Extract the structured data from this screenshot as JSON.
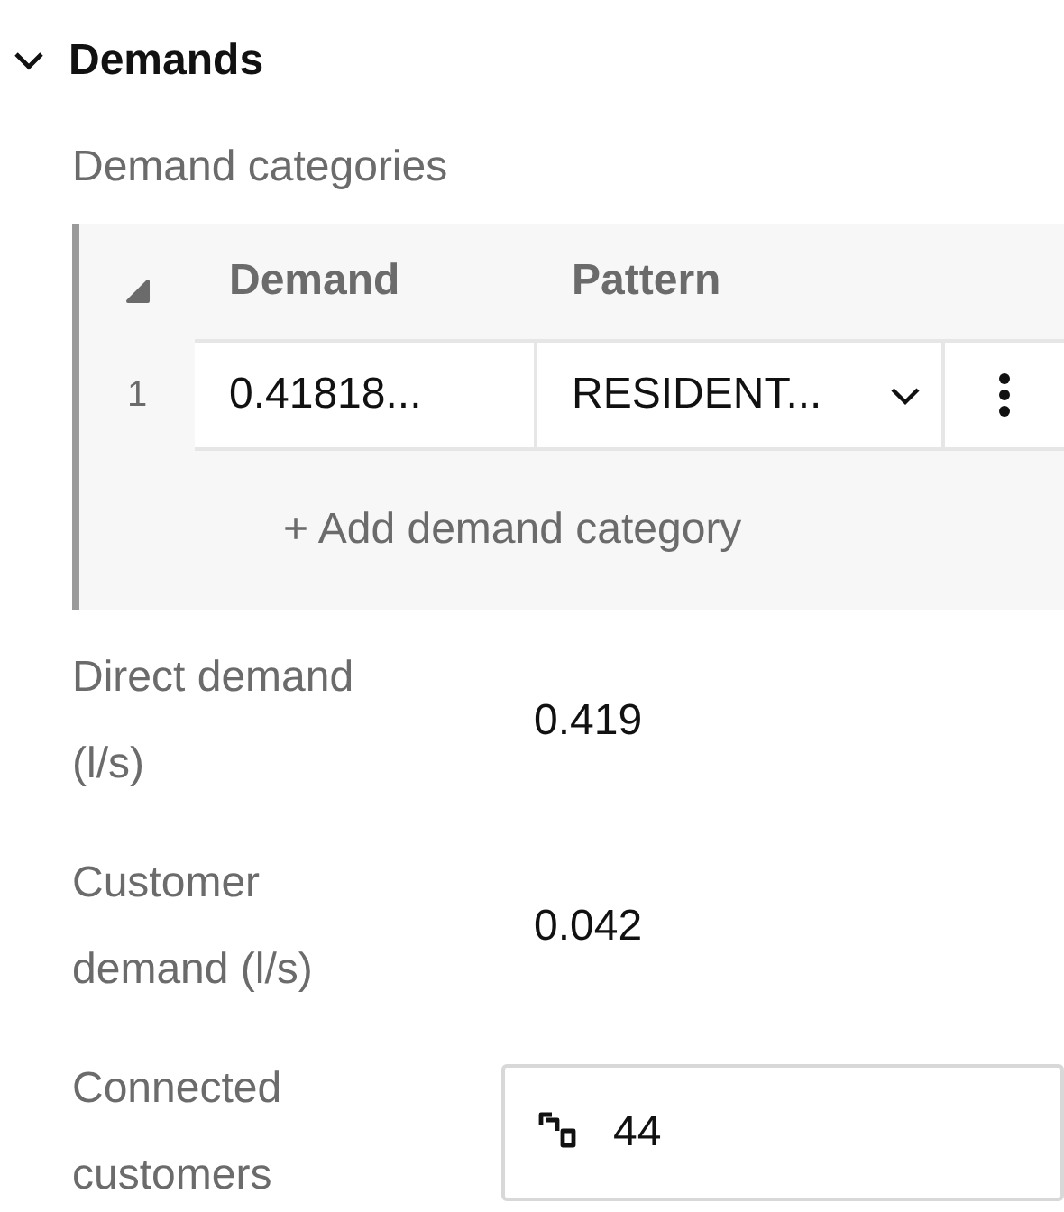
{
  "section": {
    "title": "Demands",
    "expanded": true
  },
  "categories_label": "Demand categories",
  "table": {
    "columns": [
      "Demand",
      "Pattern"
    ],
    "rows": [
      {
        "index": "1",
        "demand": "0.41818...",
        "pattern": "RESIDENT..."
      }
    ],
    "add_button": "+ Add demand category"
  },
  "properties": [
    {
      "kind": "text",
      "label": "Direct demand (l/s)",
      "value": "0.419"
    },
    {
      "kind": "text",
      "label": "Customer demand (l/s)",
      "value": "0.042"
    },
    {
      "kind": "field",
      "label": "Connected customers",
      "value": "44"
    }
  ]
}
